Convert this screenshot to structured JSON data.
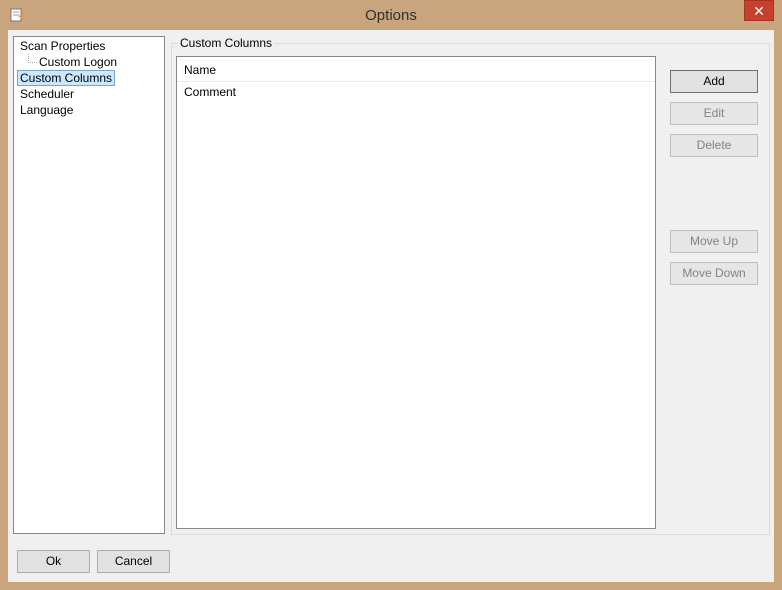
{
  "window": {
    "title": "Options",
    "close_glyph": "✕"
  },
  "tree": {
    "items": [
      {
        "label": "Scan Properties"
      },
      {
        "label": "Custom Logon"
      },
      {
        "label": "Custom Columns"
      },
      {
        "label": "Scheduler"
      },
      {
        "label": "Language"
      }
    ]
  },
  "custom_columns": {
    "group_label": "Custom Columns",
    "column_header": "Name",
    "rows": [
      "Comment"
    ],
    "buttons": {
      "add": "Add",
      "edit": "Edit",
      "delete": "Delete",
      "move_up": "Move Up",
      "move_down": "Move Down"
    }
  },
  "footer": {
    "ok": "Ok",
    "cancel": "Cancel"
  },
  "colors": {
    "frame": "#c9a57d",
    "close": "#c7402c",
    "selection": "#cce8ff"
  },
  "icons": {
    "app": "options-document-icon",
    "close": "close-icon"
  }
}
